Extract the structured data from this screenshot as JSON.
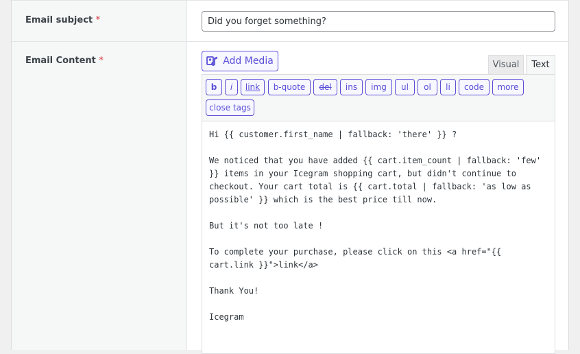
{
  "form": {
    "subject_label": "Email subject",
    "content_label": "Email Content",
    "required_mark": "*",
    "subject_value": "Did you forget something?"
  },
  "editor": {
    "add_media_label": "Add Media",
    "tabs": {
      "visual": "Visual",
      "text": "Text",
      "active": "Text"
    },
    "quicktags": [
      "b",
      "i",
      "link",
      "b-quote",
      "del",
      "ins",
      "img",
      "ul",
      "ol",
      "li",
      "code",
      "more",
      "close tags"
    ],
    "content": "Hi {{ customer.first_name | fallback: 'there' }} ?\n\nWe noticed that you have added {{ cart.item_count | fallback: 'few' }} items in your Icegram shopping cart, but didn't continue to checkout. Your cart total is {{ cart.total | fallback: 'as low as possible' }} which is the best price till now.\n\nBut it's not too late !\n\nTo complete your purchase, please click on this <a href=\"{{ cart.link }}\">link</a>\n\nThank You!\n\nIcegram"
  },
  "colors": {
    "accent": "#5b4ed8",
    "required": "#d63638"
  }
}
